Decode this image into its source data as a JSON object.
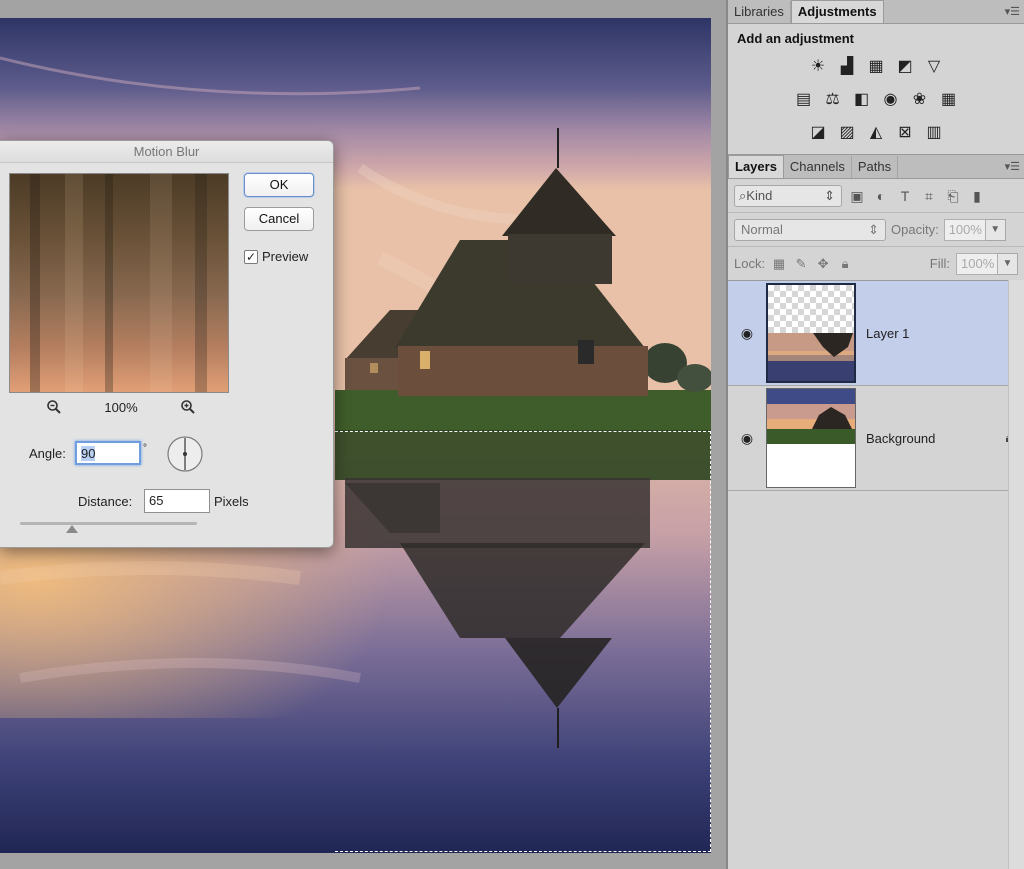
{
  "dialog": {
    "title": "Motion Blur",
    "ok_label": "OK",
    "cancel_label": "Cancel",
    "preview_label": "Preview",
    "preview_checked": true,
    "zoom_level": "100%",
    "angle_label": "Angle:",
    "angle_value": "90",
    "angle_unit": "°",
    "distance_label": "Distance:",
    "distance_value": "65",
    "distance_unit": "Pixels"
  },
  "adjustments_panel": {
    "tabs": [
      "Libraries",
      "Adjustments"
    ],
    "active_tab": "Adjustments",
    "title": "Add an adjustment",
    "icons": [
      [
        "brightness-contrast-icon",
        "levels-icon",
        "curves-icon",
        "exposure-icon",
        "vibrance-icon"
      ],
      [
        "hue-saturation-icon",
        "color-balance-icon",
        "black-white-icon",
        "photo-filter-icon",
        "channel-mixer-icon",
        "color-lookup-icon"
      ],
      [
        "invert-icon",
        "posterize-icon",
        "threshold-icon",
        "selective-color-icon",
        "gradient-map-icon"
      ]
    ]
  },
  "layers_panel": {
    "tabs": [
      "Layers",
      "Channels",
      "Paths"
    ],
    "active_tab": "Layers",
    "kind_label": "Kind",
    "blend_mode": "Normal",
    "opacity_label": "Opacity:",
    "opacity_value": "100%",
    "lock_label": "Lock:",
    "fill_label": "Fill:",
    "fill_value": "100%",
    "layers": [
      {
        "name": "Layer 1",
        "visible": true,
        "selected": true,
        "locked": false
      },
      {
        "name": "Background",
        "visible": true,
        "selected": false,
        "locked": true
      }
    ]
  },
  "colors": {
    "selection_highlight": "#c3cfea",
    "accent_focus": "#6e9ee0"
  }
}
